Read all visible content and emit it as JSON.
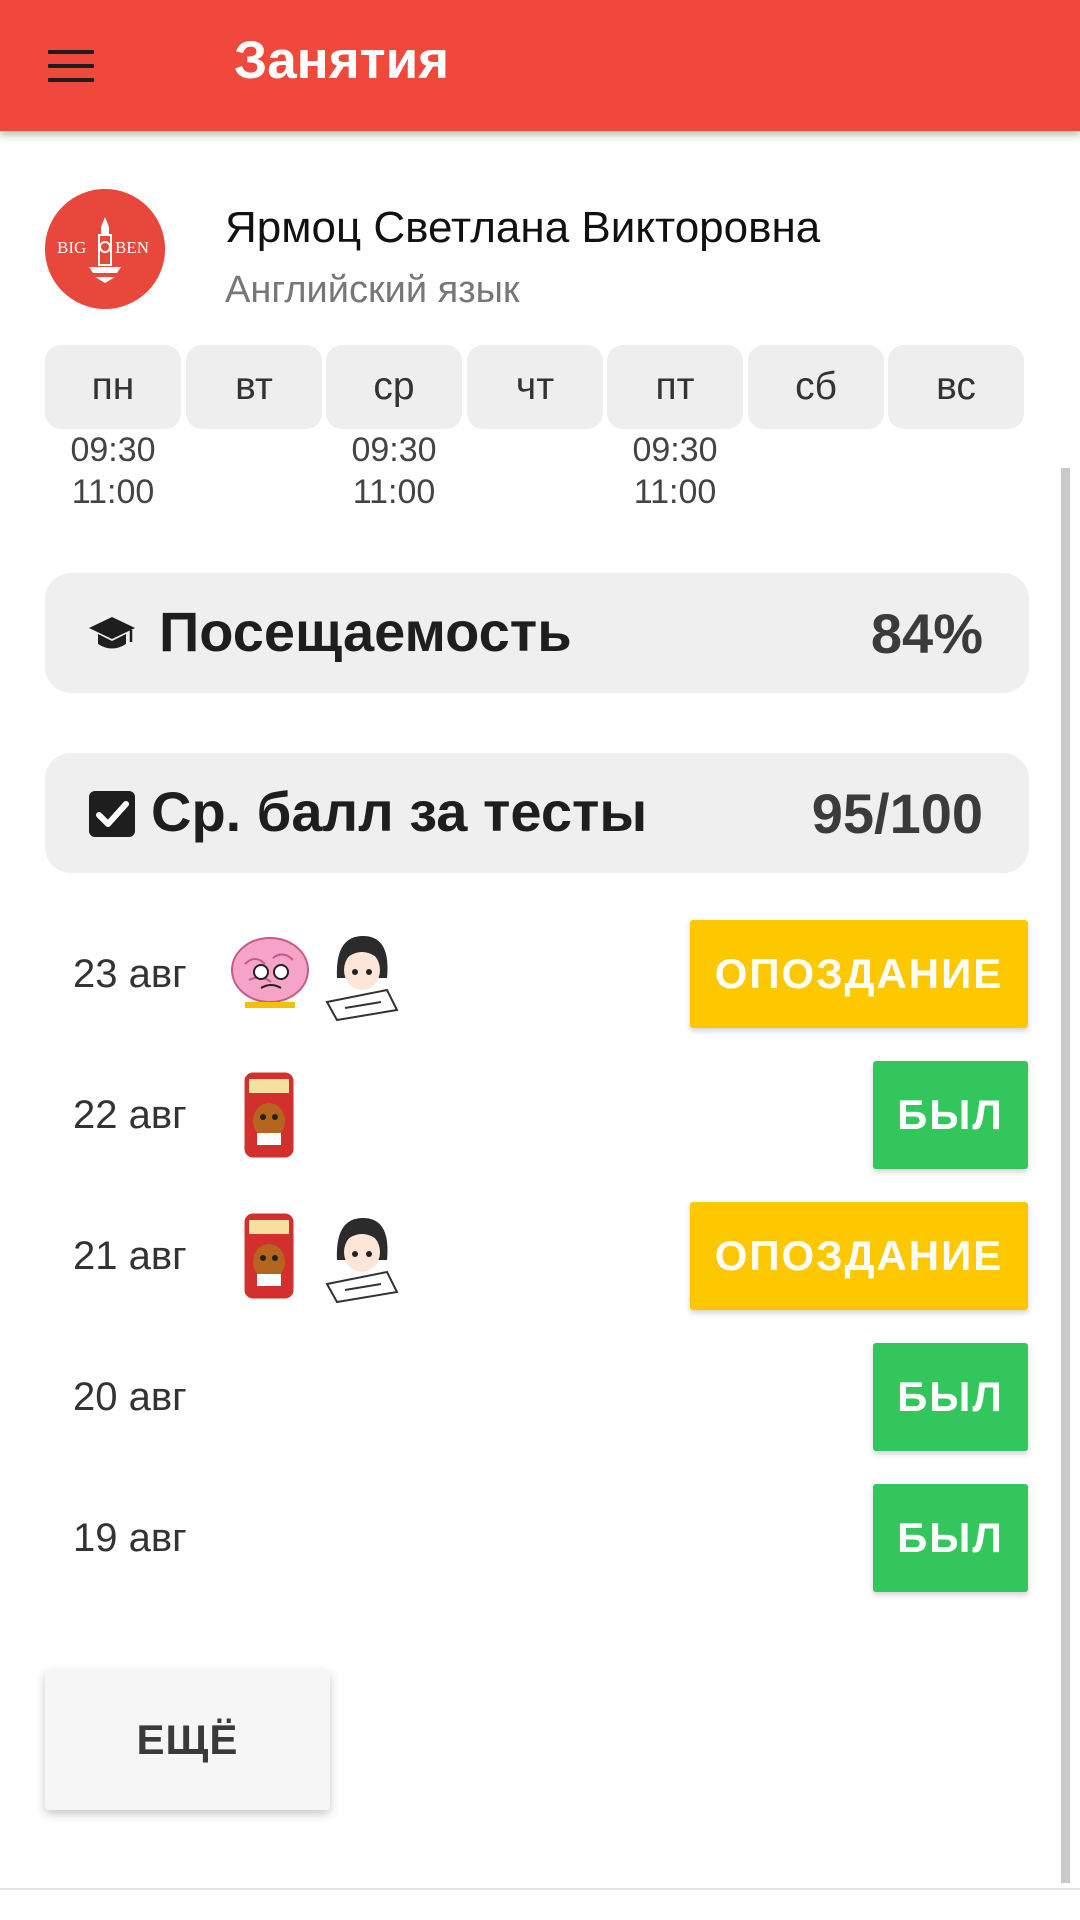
{
  "app_bar": {
    "title": "Занятия"
  },
  "teacher": {
    "name": "Ярмоц Светлана Викторовна",
    "subject": "Английский язык",
    "logo": {
      "left": "BIG",
      "right": "BEN"
    }
  },
  "schedule": [
    {
      "day": "пн",
      "times": [
        "09:30",
        "11:00"
      ]
    },
    {
      "day": "вт",
      "times": []
    },
    {
      "day": "ср",
      "times": [
        "09:30",
        "11:00"
      ]
    },
    {
      "day": "чт",
      "times": []
    },
    {
      "day": "пт",
      "times": [
        "09:30",
        "11:00"
      ]
    },
    {
      "day": "сб",
      "times": []
    },
    {
      "day": "вс",
      "times": []
    }
  ],
  "attendance": {
    "label": "Посещаемость",
    "value": "84%",
    "icon": "graduation-cap-icon"
  },
  "tests": {
    "label": "Ср. балл за тесты",
    "value": "95/100",
    "icon": "checkbox-icon"
  },
  "lessons": [
    {
      "date": "23 авг",
      "stickers": [
        "brain-sticker",
        "anime-girl-sticker"
      ],
      "status": "ОПОЗДАНИЕ",
      "status_type": "late"
    },
    {
      "date": "22 авг",
      "stickers": [
        "dog-homework-sticker"
      ],
      "status": "БЫЛ",
      "status_type": "present"
    },
    {
      "date": "21 авг",
      "stickers": [
        "dog-homework-sticker",
        "anime-girl-sticker"
      ],
      "status": "ОПОЗДАНИЕ",
      "status_type": "late"
    },
    {
      "date": "20 авг",
      "stickers": [],
      "status": "БЫЛ",
      "status_type": "present"
    },
    {
      "date": "19 авг",
      "stickers": [],
      "status": "БЫЛ",
      "status_type": "present"
    }
  ],
  "more_button": {
    "label": "ЕЩЁ"
  },
  "colors": {
    "app_bar": "#f1483c",
    "late": "#fdc800",
    "present": "#33c65c",
    "card": "#efefef"
  }
}
